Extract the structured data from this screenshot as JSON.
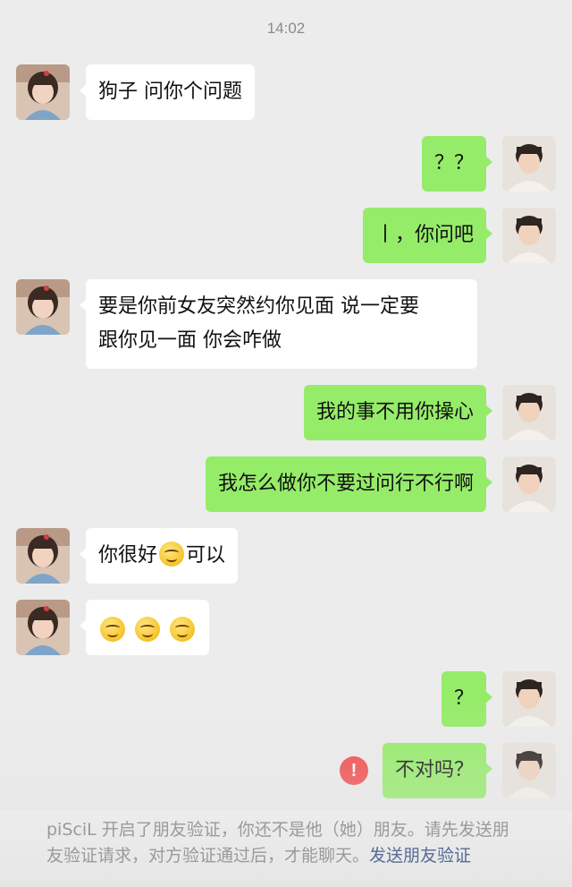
{
  "timestamp": "14:02",
  "messages": [
    {
      "side": "in",
      "text": "狗子 问你个问题"
    },
    {
      "side": "out",
      "text": "？？"
    },
    {
      "side": "out",
      "text": "丨，你问吧"
    },
    {
      "side": "in",
      "line1": "要是你前女友突然约你见面 说一定要",
      "line2": "跟你见一面  你会咋做"
    },
    {
      "side": "out",
      "text": "我的事不用你操心"
    },
    {
      "side": "out",
      "text": "我怎么做你不要过问行不行啊"
    },
    {
      "side": "in",
      "text_before": "你很好",
      "emoji": "smile-emoji",
      "text_after": "可以"
    },
    {
      "side": "in",
      "emojis": [
        "smile-emoji",
        "smile-emoji",
        "smile-emoji"
      ]
    },
    {
      "side": "out",
      "text": "？"
    },
    {
      "side": "out",
      "text": "不对吗？",
      "status": "send-failed",
      "status_icon": "!"
    }
  ],
  "notice": {
    "text": "piSciL 开启了朋友验证，你还不是他（她）朋友。请先发送朋友验证请求，对方验证通过后，才能聊天。",
    "link": "发送朋友验证"
  },
  "colors": {
    "background": "#ececec",
    "incoming_bubble": "#ffffff",
    "outgoing_bubble": "#95ec69",
    "error": "#f24a4a",
    "link": "#576b95"
  }
}
